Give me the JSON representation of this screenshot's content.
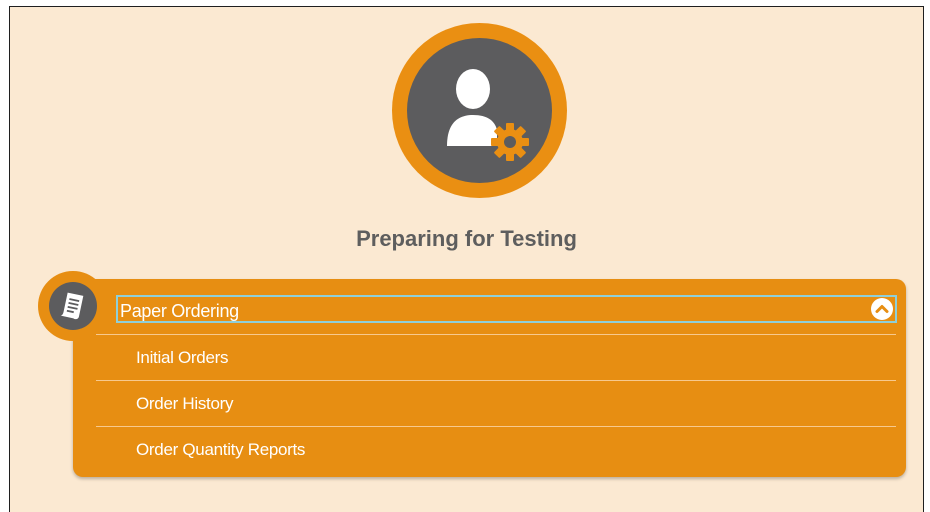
{
  "page": {
    "title": "Preparing for Testing",
    "hero_icon": "user-gear-icon"
  },
  "colors": {
    "background": "#fbe9d2",
    "accent": "#e78e12",
    "icon_circle": "#5c5c5e",
    "focus_outline": "#8fcfd8"
  },
  "panel": {
    "icon": "document-icon",
    "header_label": "Paper Ordering",
    "expanded": true,
    "toggle_icon": "chevron-up-icon",
    "items": [
      {
        "label": "Initial Orders"
      },
      {
        "label": "Order History"
      },
      {
        "label": "Order Quantity Reports"
      }
    ]
  }
}
